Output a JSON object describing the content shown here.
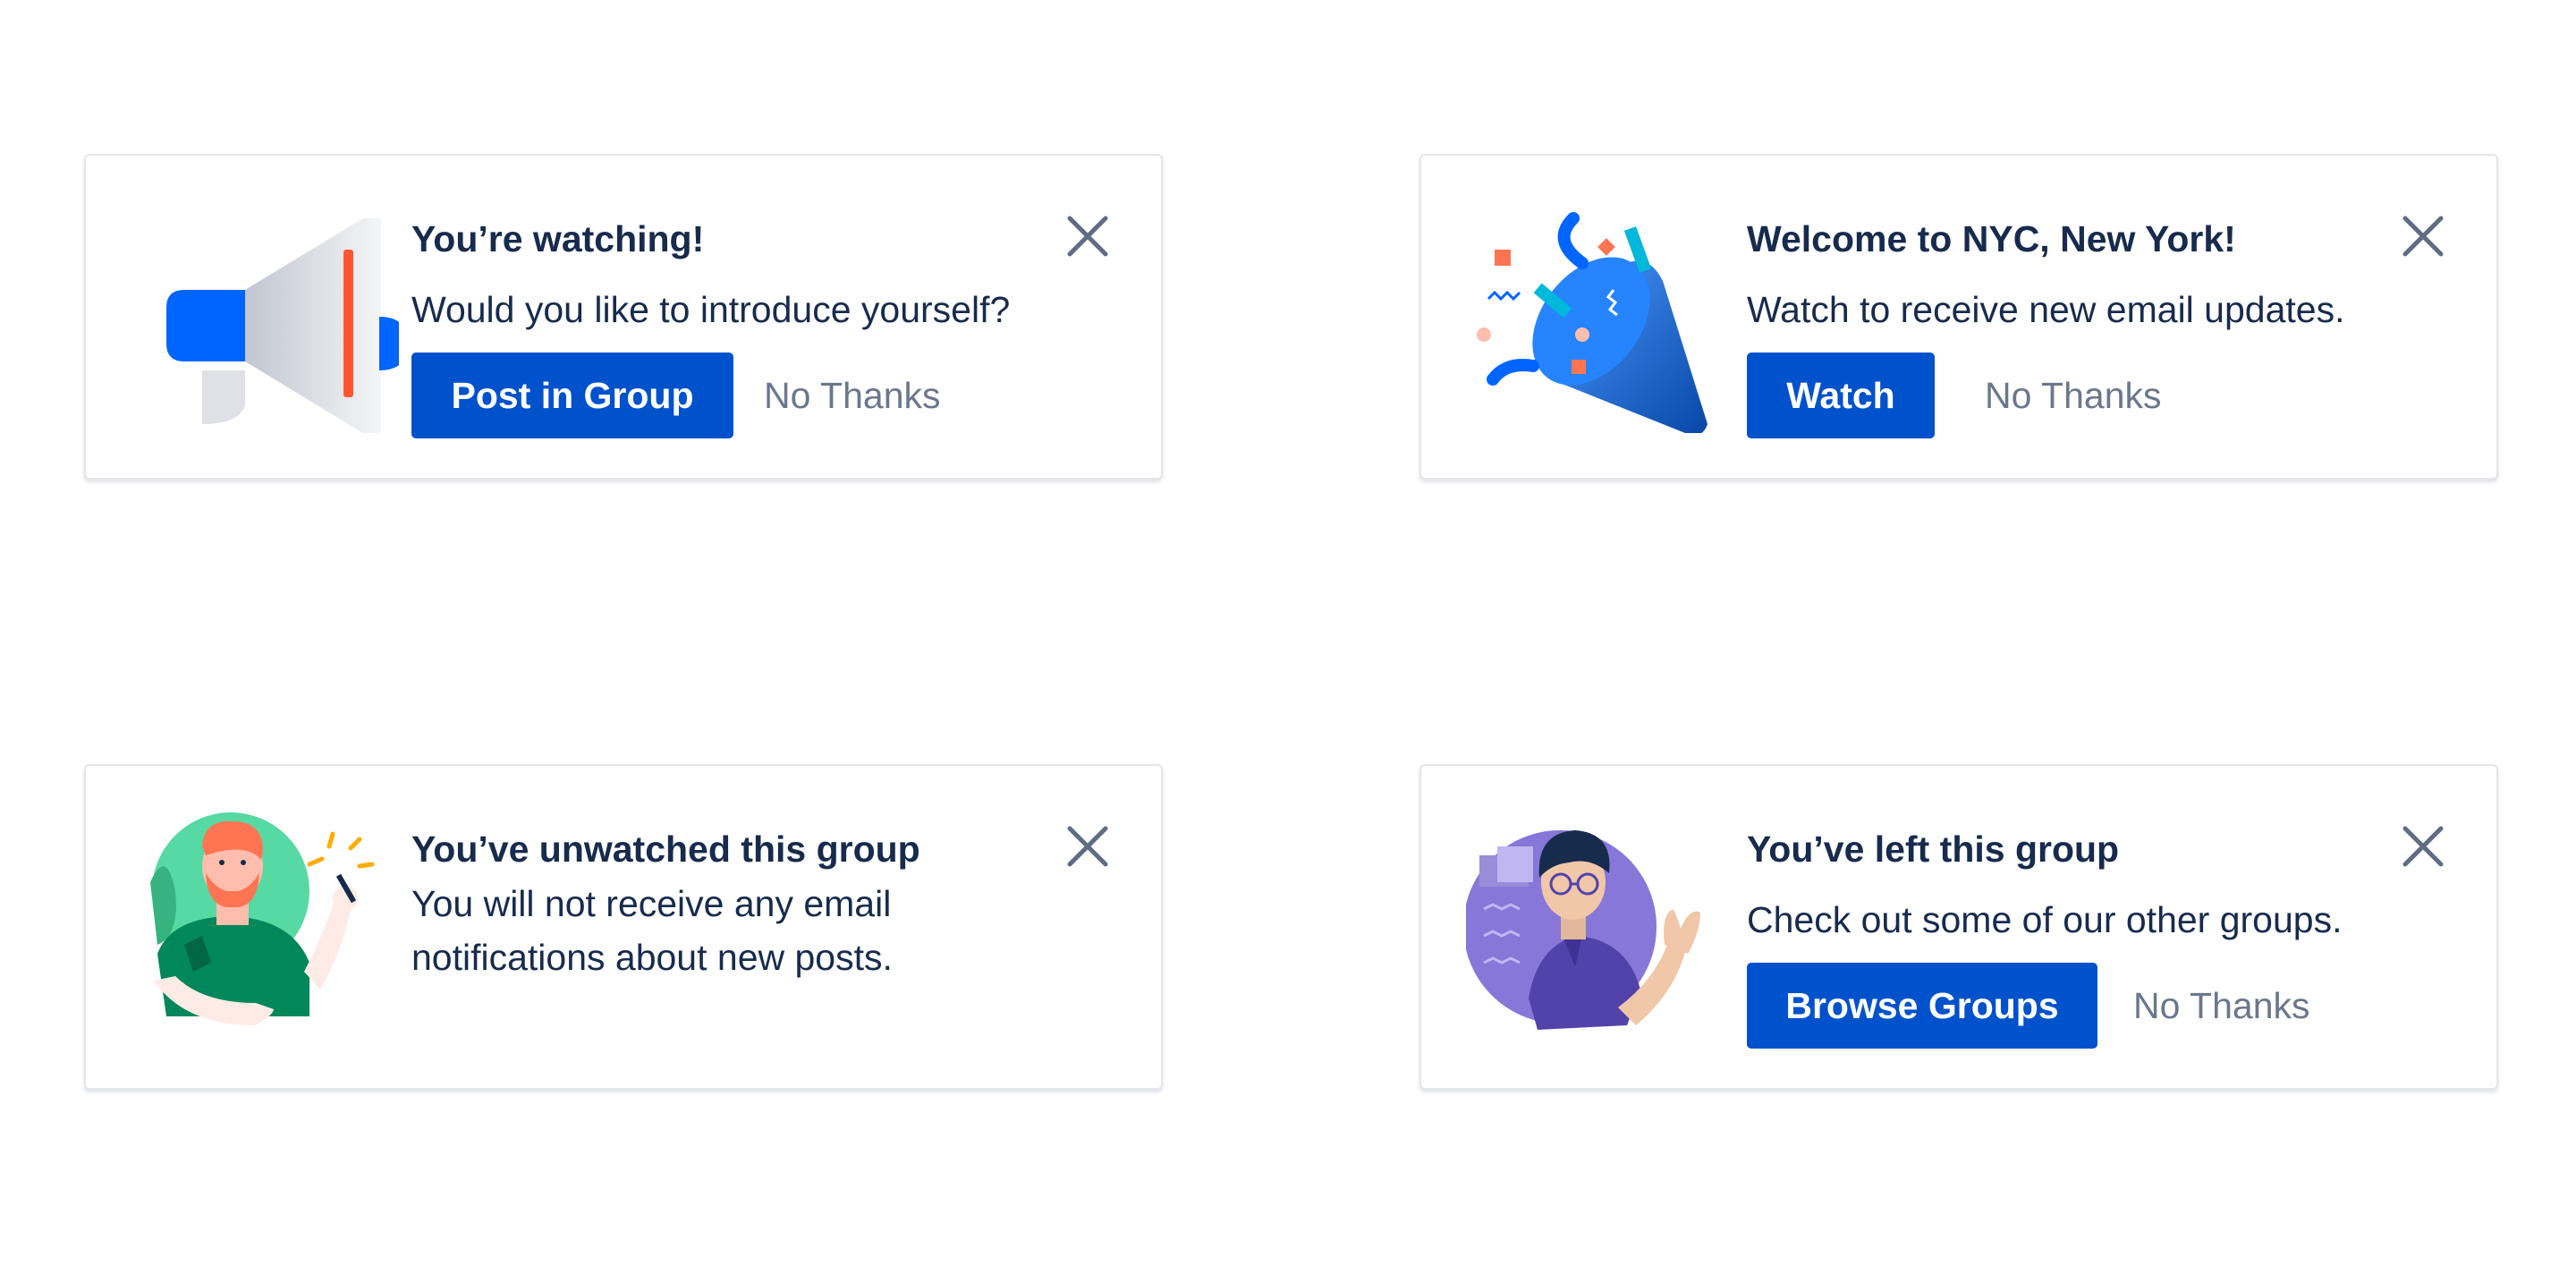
{
  "colors": {
    "primary": "#0052cc",
    "text": "#172b4d",
    "subtle_text": "#6b778c",
    "close_icon": "#5e6c84",
    "card_border": "#e4e6ea"
  },
  "cards": [
    {
      "illustration_icon": "megaphone-icon",
      "title": "You’re watching!",
      "body": "Would you like to introduce yourself?",
      "primary_label": "Post in Group",
      "secondary_label": "No Thanks",
      "close_icon": "close-icon"
    },
    {
      "illustration_icon": "party-popper-icon",
      "title": "Welcome to NYC, New York!",
      "body": "Watch to receive new email updates.",
      "primary_label": "Watch",
      "secondary_label": "No Thanks",
      "close_icon": "close-icon"
    },
    {
      "illustration_icon": "person-writing-icon",
      "title": "You’ve unwatched this group",
      "body_lines": [
        "You will not receive any email",
        "notifications about new posts."
      ],
      "close_icon": "close-icon"
    },
    {
      "illustration_icon": "person-waving-icon",
      "title": "You’ve left this group",
      "body": "Check out some of our other groups.",
      "primary_label": "Browse Groups",
      "secondary_label": "No Thanks",
      "close_icon": "close-icon"
    }
  ]
}
